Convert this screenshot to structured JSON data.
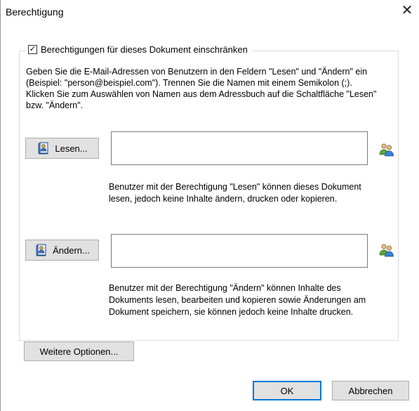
{
  "dialog": {
    "title": "Berechtigung",
    "close_glyph": "✕"
  },
  "restrict": {
    "label": "Berechtigungen für dieses Dokument einschränken",
    "checked": true,
    "check_glyph": "✓"
  },
  "intro_text": "Geben Sie die E-Mail-Adressen von Benutzern in den Feldern \"Lesen\" und \"Ändern\" ein (Beispiel: \"person@beispiel.com\"). Trennen Sie die Namen mit einem Semikolon (;). Klicken Sie zum Auswählen von Namen aus dem Adressbuch auf die Schaltfläche \"Lesen\" bzw. \"Ändern\".",
  "read": {
    "button_label": "Lesen...",
    "field_value": "",
    "description": "Benutzer mit der Berechtigung \"Lesen\" können dieses Dokument lesen, jedoch keine Inhalte ändern, drucken oder kopieren."
  },
  "change": {
    "button_label": "Ändern...",
    "field_value": "",
    "description": "Benutzer mit der Berechtigung \"Ändern\" können Inhalte des Dokuments lesen, bearbeiten und kopieren sowie Änderungen am Dokument speichern, sie können jedoch keine Inhalte drucken."
  },
  "more_options_label": "Weitere Optionen...",
  "footer": {
    "ok_label": "OK",
    "cancel_label": "Abbrechen"
  },
  "icons": {
    "addressbook": "address-book-icon",
    "users": "users-icon"
  }
}
